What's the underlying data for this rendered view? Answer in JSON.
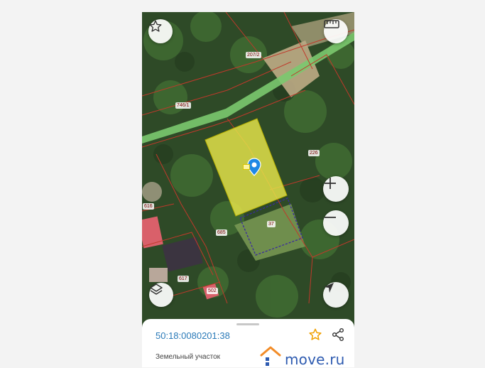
{
  "map": {
    "parcel_labels": {
      "p207": "207/2",
      "p746": "746/1",
      "p226": "226",
      "p616": "616",
      "p685": "685",
      "p37": "37",
      "p617": "617",
      "p502": "502"
    },
    "icons": {
      "favorite": "star-outline-icon",
      "ruler": "ruler-icon",
      "zoom_in": "plus-icon",
      "zoom_out": "minus-icon",
      "layers": "layers-icon",
      "locate": "navigation-arrow-icon",
      "marker": "location-pin-icon"
    },
    "colors": {
      "selected_parcel": "#e8e64a",
      "parcel_border": "#c0392b",
      "marker": "#1e88e5",
      "boundary_dashed": "#3a2aa0",
      "road": "#7bc96f"
    }
  },
  "sheet": {
    "cadastral_number": "50:18:0080201:38",
    "parcel_type": "Земельный участок",
    "star_color": "#f0a000"
  },
  "watermark": {
    "text": "move.ru",
    "color": "#2e5bb0"
  }
}
